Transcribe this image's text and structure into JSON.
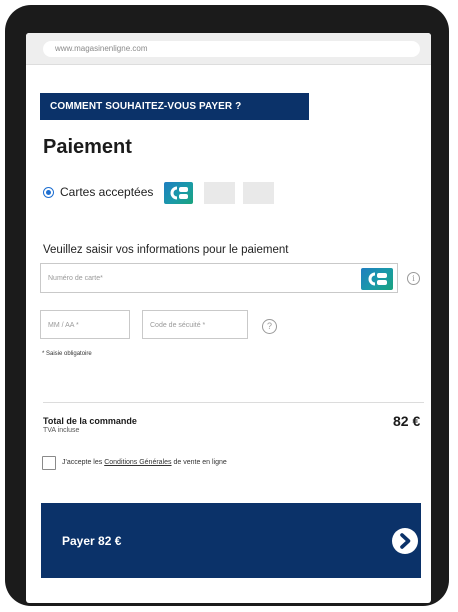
{
  "browser": {
    "url": "www.magasinenligne.com"
  },
  "checkout": {
    "section_banner": "COMMENT SOUHAITEZ-VOUS PAYER ?",
    "title": "Paiement",
    "payment_method": {
      "label": "Cartes acceptées",
      "selected": true,
      "logo": "carte-bancaire-cb-logo"
    },
    "form": {
      "title": "Veuillez saisir vos informations pour le paiement",
      "card_number_placeholder": "Numéro de carte*",
      "expiry_placeholder": "MM / AA *",
      "cvv_placeholder": "Code de sécuité *",
      "info_icon": "i",
      "help_icon": "?",
      "required_note": "* Saisie obligatoire"
    },
    "total": {
      "label": "Total de la commande",
      "sub": "TVA incluse",
      "amount": "82 €"
    },
    "terms": {
      "prefix": "J'accepte les ",
      "link": "Conditions Générales",
      "suffix": " de vente en ligne",
      "checked": false
    },
    "pay_button": {
      "label": "Payer 82 €"
    }
  },
  "colors": {
    "brand_navy": "#0b3269",
    "radio_blue": "#1e6fd1",
    "cb_teal": "#1a9aa8"
  }
}
